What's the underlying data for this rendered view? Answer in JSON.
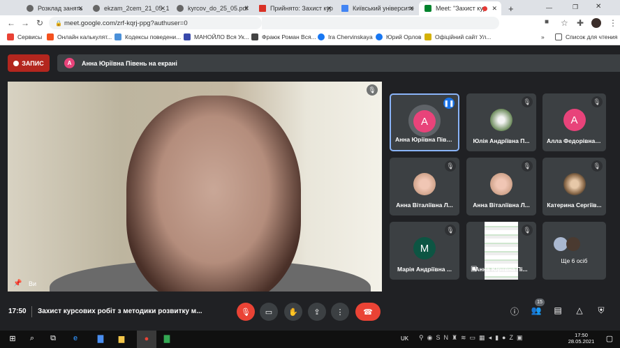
{
  "browser": {
    "tabs": [
      {
        "title": "Розклад занять",
        "active": false
      },
      {
        "title": "ekzam_2cem_21_05_1",
        "active": false
      },
      {
        "title": "kyrcov_do_25_05.pdf",
        "active": false
      },
      {
        "title": "Прийнято: Захист кур",
        "active": false
      },
      {
        "title": "Київський університе",
        "active": false
      },
      {
        "title": "Meet: \"Захист кур",
        "active": true
      }
    ],
    "new_tab": "+",
    "url": "meet.google.com/zrf-kqrj-ppg?authuser=0",
    "bookmarks": [
      "Сервисы",
      "Онлайн калькулят...",
      "Кодексы поведени...",
      "МАНОЙЛО Вся Ук...",
      "Фраюк Роман Вся...",
      "Ira Chervinskaya",
      "Юрий Орлов",
      "Офіційний сайт Ул..."
    ],
    "more_bookmarks": "»",
    "reading_list": "Список для чтения"
  },
  "meet": {
    "recording_label": "ЗАПИС",
    "presenting": {
      "initial": "А",
      "text": "Анна Юріївна Півень на екрані"
    },
    "self_label": "Ви",
    "tiles": [
      {
        "name": "Анна Юріївна Півень",
        "initial": "А",
        "color": "#e8437a",
        "speaking": true
      },
      {
        "name": "Юлія Андріївна П...",
        "photo": true
      },
      {
        "name": "Алла Федорівна І...",
        "initial": "А",
        "color": "#e8437a"
      },
      {
        "name": "Анна Віталіївна Л...",
        "photo": true
      },
      {
        "name": "Анна Віталіївна Л...",
        "photo": true
      },
      {
        "name": "Катерина Сергіїв...",
        "photo": true
      },
      {
        "name": "Марія Андріївна ...",
        "initial": "М",
        "color": "#0d5543"
      },
      {
        "name": "Анна Юріївна Пі...",
        "presentation": true
      },
      {
        "name": "Ще 6 осіб",
        "more": true
      }
    ],
    "bottom": {
      "time": "17:50",
      "meeting_title": "Захист курсових робіт з методики розвитку м...",
      "participants_count": "15"
    }
  },
  "taskbar": {
    "lang": "UK",
    "time": "17:50",
    "date": "28.05.2021"
  },
  "colors": {
    "meet_bg": "#202124",
    "tile_bg": "#3c4043",
    "record_red": "#b3261e",
    "end_call_red": "#ea4335",
    "accent": "#8ab4f8"
  }
}
